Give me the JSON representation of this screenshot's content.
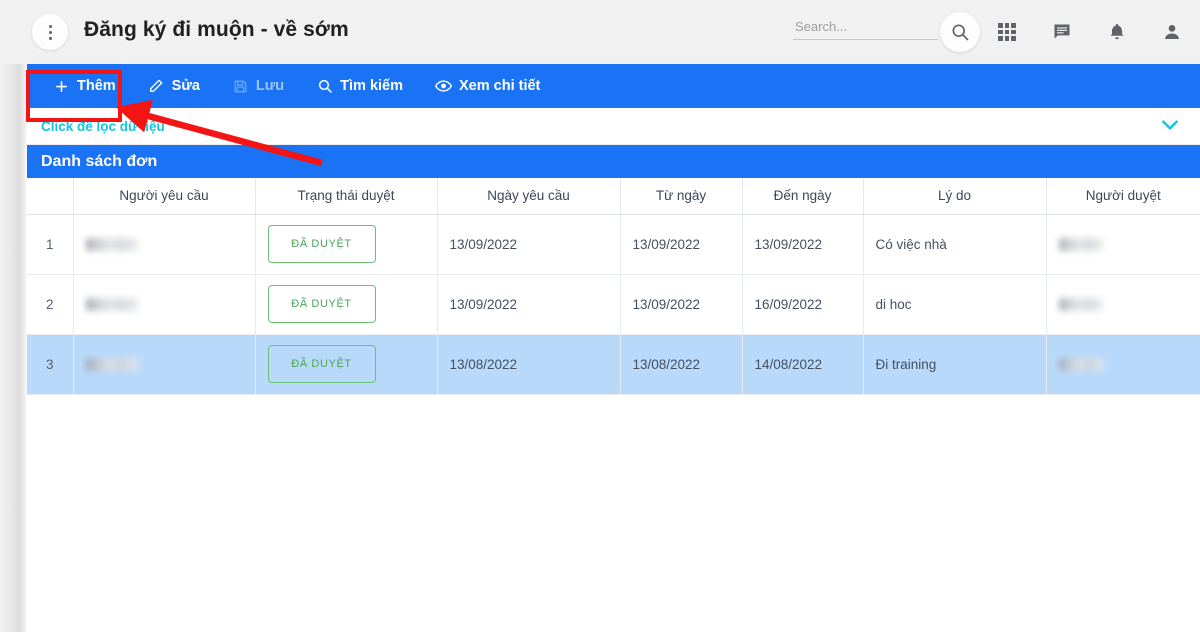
{
  "header": {
    "menu_icon": "kebab-menu-icon",
    "title": "Đăng ký đi muộn - về sớm",
    "search_placeholder": "Search...",
    "search_value": "",
    "icons": [
      "search-icon",
      "apps-grid-icon",
      "chat-icon",
      "bell-icon",
      "user-icon"
    ]
  },
  "toolbar": {
    "items": [
      {
        "label": "Thêm",
        "icon": "plus-icon",
        "disabled": false,
        "highlighted": true
      },
      {
        "label": "Sửa",
        "icon": "pencil-icon",
        "disabled": false,
        "highlighted": false
      },
      {
        "label": "Lưu",
        "icon": "save-floppy-icon",
        "disabled": true,
        "highlighted": false
      },
      {
        "label": "Tìm kiếm",
        "icon": "search-icon",
        "disabled": false,
        "highlighted": false
      },
      {
        "label": "Xem chi tiết",
        "icon": "eye-icon",
        "disabled": false,
        "highlighted": false
      }
    ]
  },
  "filter": {
    "label": "Click để lọc dữ liệu",
    "expand_icon": "chevron-down-icon"
  },
  "section": {
    "title": "Danh sách đơn"
  },
  "table": {
    "columns": [
      "",
      "Người yêu cầu",
      "Trạng thái duyệt",
      "Ngày yêu cầu",
      "Từ ngày",
      "Đến ngày",
      "Lý do",
      "Người duyệt"
    ],
    "rows": [
      {
        "index": "1",
        "requester": "",
        "status": "ĐÃ DUYỆT",
        "request_date": "13/09/2022",
        "from_date": "13/09/2022",
        "to_date": "13/09/2022",
        "reason": "Có việc nhà",
        "approver": "",
        "selected": false
      },
      {
        "index": "2",
        "requester": "",
        "status": "ĐÃ DUYỆT",
        "request_date": "13/09/2022",
        "from_date": "13/09/2022",
        "to_date": "16/09/2022",
        "reason": "di hoc",
        "approver": "",
        "selected": true
      },
      {
        "index": "3",
        "requester": "",
        "status": "ĐÃ DUYỆT",
        "request_date": "13/08/2022",
        "from_date": "13/08/2022",
        "to_date": "14/08/2022",
        "reason": "Đi training",
        "approver": "",
        "selected": false
      }
    ]
  },
  "colors": {
    "primary_blue": "#1a73f5",
    "cyan_link": "#17c3e0",
    "badge_green": "#4aa357",
    "annotation_red": "#f51414",
    "selected_row": "#b9d9fb",
    "topbar_gray": "#f1f1f1"
  }
}
